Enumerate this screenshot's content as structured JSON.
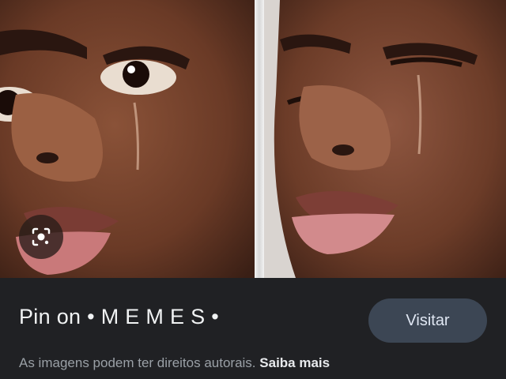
{
  "image": {
    "panels": [
      "crying-face-eyes-open",
      "crying-face-eyes-closed"
    ],
    "lens_icon": "google-lens-icon"
  },
  "info": {
    "title": "Pin on • M E M E S •",
    "visit_label": "Visitar",
    "copyright_text": "As imagens podem ter direitos autorais.",
    "learn_more_label": "Saiba mais"
  },
  "colors": {
    "background": "#202124",
    "button_bg": "#3c4654",
    "text_primary": "#f1f3f4",
    "text_secondary": "#9aa0a6"
  }
}
